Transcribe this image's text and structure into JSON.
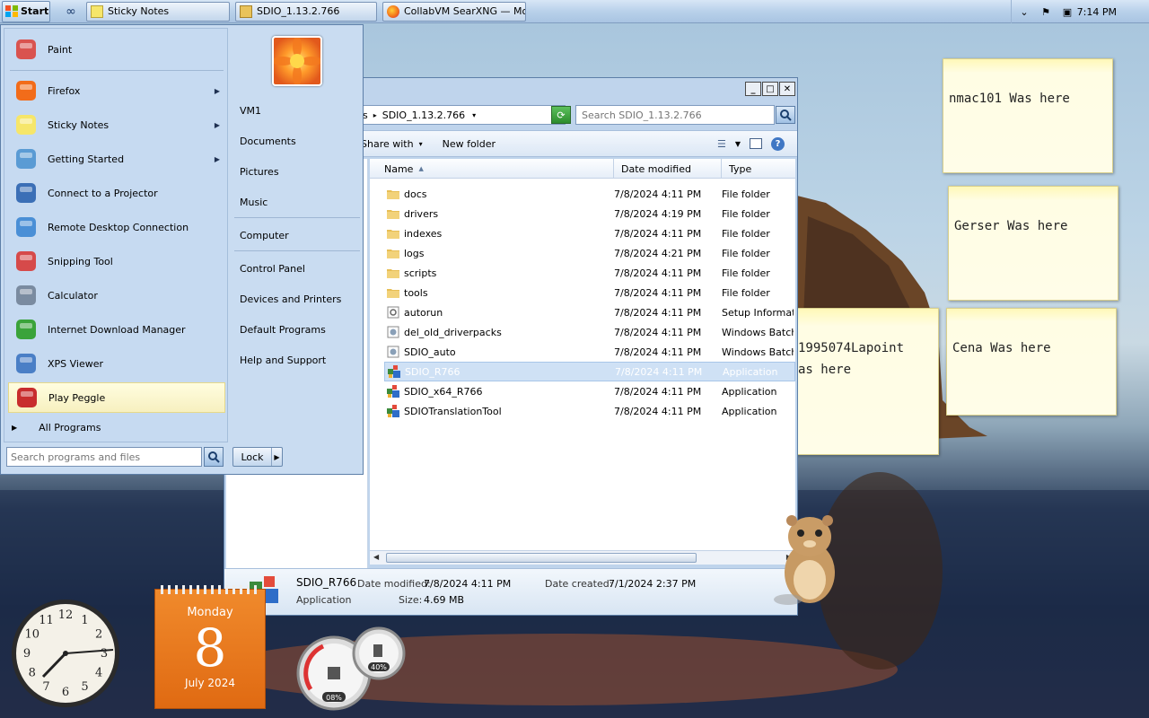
{
  "taskbar": {
    "start_label": "Start",
    "tasks": [
      {
        "label": "Sticky Notes"
      },
      {
        "label": "SDIO_1.13.2.766"
      },
      {
        "label": "CollabVM SearXNG — Mo..."
      }
    ],
    "clock": "7:14 PM",
    "tray_icons": [
      "chevron-icon",
      "flag-icon",
      "network-icon"
    ]
  },
  "start_menu": {
    "programs": [
      {
        "label": "Paint",
        "icon": "paint-icon"
      },
      {
        "label": "Firefox",
        "icon": "firefox-icon",
        "submenu": true
      },
      {
        "label": "Sticky Notes",
        "icon": "sticky-notes-icon",
        "submenu": true
      },
      {
        "label": "Getting Started",
        "icon": "getting-started-icon",
        "submenu": true
      },
      {
        "label": "Connect to a Projector",
        "icon": "projector-icon"
      },
      {
        "label": "Remote Desktop Connection",
        "icon": "remote-desktop-icon"
      },
      {
        "label": "Snipping Tool",
        "icon": "snipping-tool-icon"
      },
      {
        "label": "Calculator",
        "icon": "calculator-icon"
      },
      {
        "label": "Internet Download Manager",
        "icon": "idm-icon"
      },
      {
        "label": "XPS Viewer",
        "icon": "xps-viewer-icon"
      },
      {
        "label": "Play Peggle",
        "icon": "peggle-icon"
      }
    ],
    "all_programs": "All Programs",
    "search_placeholder": "Search programs and files",
    "right_items": [
      {
        "label": "VM1"
      },
      {
        "label": "Documents"
      },
      {
        "label": "Pictures"
      },
      {
        "label": "Music"
      },
      {
        "label": "Computer"
      },
      {
        "label": "Control Panel"
      },
      {
        "label": "Devices and Printers"
      },
      {
        "label": "Default Programs"
      },
      {
        "label": "Help and Support"
      }
    ],
    "lock_label": "Lock"
  },
  "explorer": {
    "address_segment_prefix": "ds",
    "address_segment": "SDIO_1.13.2.766",
    "search_placeholder": "Search SDIO_1.13.2.766",
    "commands": {
      "share_with": "Share with",
      "new_folder": "New folder"
    },
    "columns": {
      "name": "Name",
      "date": "Date modified",
      "type": "Type"
    },
    "files": [
      {
        "name": "docs",
        "date": "7/8/2024 4:11 PM",
        "type": "File folder",
        "icon": "folder-icon"
      },
      {
        "name": "drivers",
        "date": "7/8/2024 4:19 PM",
        "type": "File folder",
        "icon": "folder-icon"
      },
      {
        "name": "indexes",
        "date": "7/8/2024 4:11 PM",
        "type": "File folder",
        "icon": "folder-icon"
      },
      {
        "name": "logs",
        "date": "7/8/2024 4:21 PM",
        "type": "File folder",
        "icon": "folder-icon"
      },
      {
        "name": "scripts",
        "date": "7/8/2024 4:11 PM",
        "type": "File folder",
        "icon": "folder-icon"
      },
      {
        "name": "tools",
        "date": "7/8/2024 4:11 PM",
        "type": "File folder",
        "icon": "folder-icon"
      },
      {
        "name": "autorun",
        "date": "7/8/2024 4:11 PM",
        "type": "Setup Informatio",
        "icon": "settings-file-icon"
      },
      {
        "name": "del_old_driverpacks",
        "date": "7/8/2024 4:11 PM",
        "type": "Windows Batch F",
        "icon": "batch-file-icon"
      },
      {
        "name": "SDIO_auto",
        "date": "7/8/2024 4:11 PM",
        "type": "Windows Batch F",
        "icon": "batch-file-icon"
      },
      {
        "name": "SDIO_R766",
        "date": "7/8/2024 4:11 PM",
        "type": "Application",
        "icon": "app-icon",
        "selected": true
      },
      {
        "name": "SDIO_x64_R766",
        "date": "7/8/2024 4:11 PM",
        "type": "Application",
        "icon": "app-icon"
      },
      {
        "name": "SDIOTranslationTool",
        "date": "7/8/2024 4:11 PM",
        "type": "Application",
        "icon": "app-icon"
      }
    ],
    "details": {
      "name": "SDIO_R766",
      "type": "Application",
      "date_modified_label": "Date modified:",
      "date_modified": "7/8/2024 4:11 PM",
      "date_created_label": "Date created:",
      "date_created": "7/1/2024 2:37 PM",
      "size_label": "Size:",
      "size": "4.69 MB"
    }
  },
  "sticky_notes": [
    {
      "text": "nmac101 Was here"
    },
    {
      "text": "Gerser Was here"
    },
    {
      "text": "1995074Lapoint"
    },
    {
      "text": "as here"
    },
    {
      "text": "Cena Was here"
    }
  ],
  "gadgets": {
    "calendar_day": "Monday",
    "calendar_date": "8",
    "calendar_month": "July 2024",
    "cpu_percent": "08%",
    "mem_percent": "40%",
    "clock_numbers": [
      "12",
      "1",
      "2",
      "3",
      "4",
      "5",
      "6",
      "7",
      "8",
      "9",
      "10",
      "11"
    ]
  },
  "colors": {
    "accent": "#3a6ea5",
    "selection": "#cfe1f5",
    "sticky": "#fffde4",
    "calendar": "#e8761c"
  }
}
